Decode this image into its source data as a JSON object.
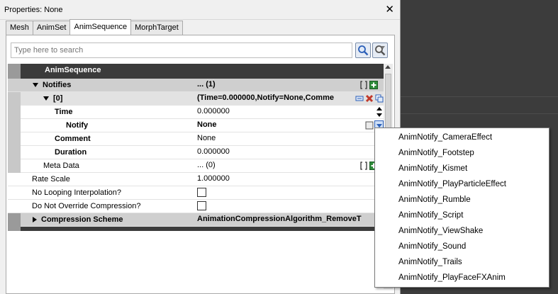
{
  "window": {
    "title": "Properties: None"
  },
  "tabs": [
    {
      "label": "Mesh"
    },
    {
      "label": "AnimSet"
    },
    {
      "label": "AnimSequence"
    },
    {
      "label": "MorphTarget"
    }
  ],
  "active_tab": "AnimSequence",
  "search": {
    "placeholder": "Type here to search",
    "value": ""
  },
  "category": {
    "title": "AnimSequence"
  },
  "properties": {
    "notifies": {
      "name": "Notifies",
      "value": "... (1)"
    },
    "item0": {
      "name": "[0]",
      "value": "(Time=0.000000,Notify=None,Comme"
    },
    "time": {
      "name": "Time",
      "value": "0.000000"
    },
    "notify": {
      "name": "Notify",
      "value": "None"
    },
    "comment": {
      "name": "Comment",
      "value": "None"
    },
    "duration": {
      "name": "Duration",
      "value": "0.000000"
    },
    "meta_data": {
      "name": "Meta Data",
      "value": "... (0)"
    },
    "rate_scale": {
      "name": "Rate Scale",
      "value": "1.000000"
    },
    "no_looping": {
      "name": "No Looping Interpolation?",
      "checked": false
    },
    "no_override": {
      "name": "Do Not Override Compression?",
      "checked": false
    },
    "compression": {
      "name": "Compression Scheme",
      "value": "AnimationCompressionAlgorithm_RemoveT"
    }
  },
  "dropdown": {
    "items": [
      "AnimNotify_CameraEffect",
      "AnimNotify_Footstep",
      "AnimNotify_Kismet",
      "AnimNotify_PlayParticleEffect",
      "AnimNotify_Rumble",
      "AnimNotify_Script",
      "AnimNotify_ViewShake",
      "AnimNotify_Sound",
      "AnimNotify_Trails",
      "AnimNotify_PlayFaceFXAnim"
    ]
  },
  "icons": {
    "close": "close-icon",
    "search": "magnifier-icon",
    "clear_search": "clear-filter-icon",
    "add": "add-icon",
    "empty": "empty-array-icon",
    "delete": "delete-icon",
    "insert": "insert-icon",
    "use_selected": "use-selected-icon",
    "browse": "dropdown-arrow-icon"
  },
  "colors": {
    "category_bg": "#3b3b3b",
    "accent_blue": "#2b5fb8",
    "delete_red": "#c0392b",
    "add_green": "#2e8b3a"
  }
}
